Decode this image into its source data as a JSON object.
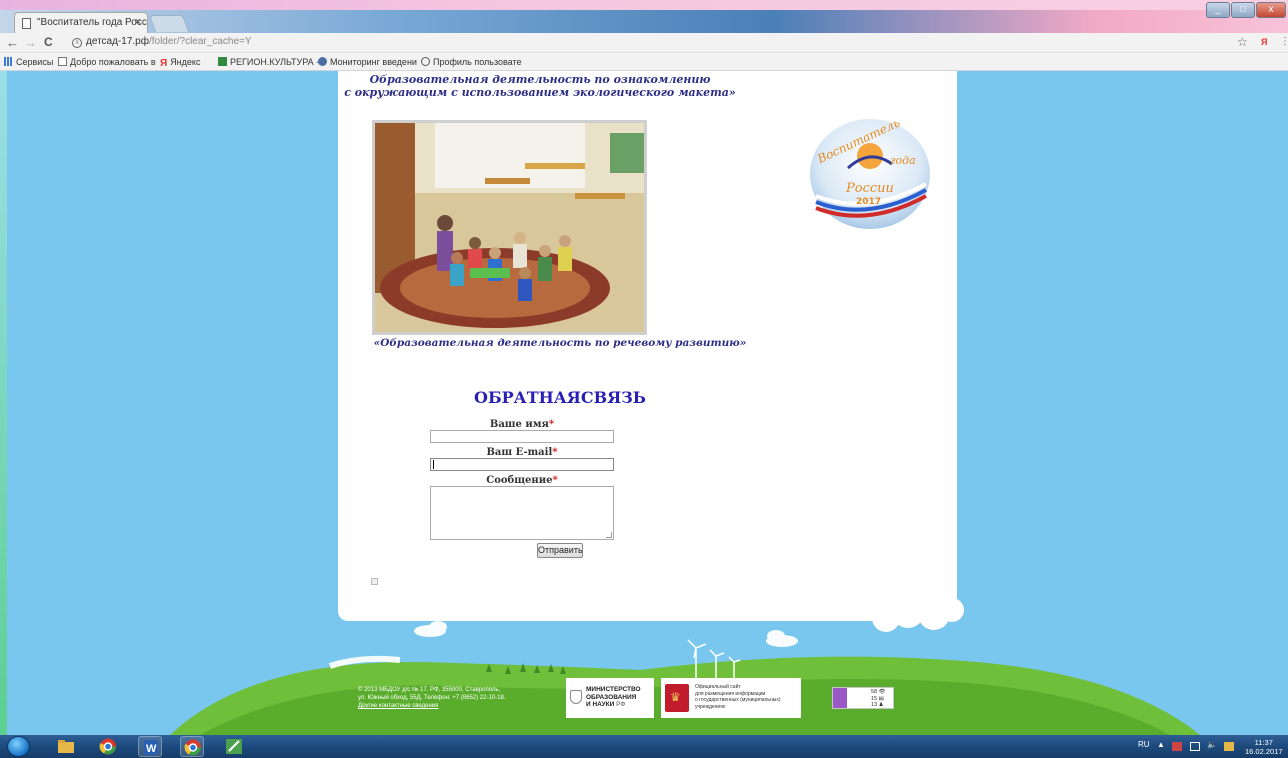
{
  "browser": {
    "tab_title": "\"Воспитатель года Росс",
    "tab_close": "×",
    "url_domain": "детсад-17.рф",
    "url_path": "/folder/?clear_cache=Y",
    "info_icon_glyph": "i",
    "nav": {
      "back": "←",
      "forward": "→",
      "reload": "C"
    },
    "star": "☆",
    "yandex_ext": "Я",
    "menu": "⋮",
    "window_controls": {
      "minimize": "_",
      "maximize": "□",
      "close": "x"
    }
  },
  "bookmarks": [
    {
      "label": "Сервисы",
      "icon": "apps-grid-icon",
      "color": "#3c78d8"
    },
    {
      "label": "Добро пожаловать в",
      "icon": "page-icon",
      "color": "#777777"
    },
    {
      "label": "Яндекс",
      "icon": "yandex-icon",
      "color": "#e3342f"
    },
    {
      "label": "РЕГИОН.КУЛЬТУРА -",
      "icon": "region-culture-icon",
      "color": "#2f8a3f"
    },
    {
      "label": "Мониторинг введени",
      "icon": "monitoring-icon",
      "color": "#4a6fa5"
    },
    {
      "label": "Профиль пользовате",
      "icon": "profile-icon",
      "color": "#555555"
    }
  ],
  "content": {
    "caption_top_line1": "Образовательная деятельность по ознакомлению",
    "caption_top_line2": "с окружающим с использованием экологического макета»",
    "caption_photo": "«Образовательная деятельность по речевому развитию»",
    "logo_text_top": "Воспитатель",
    "logo_text_mid": "года",
    "logo_text_bottom": "России",
    "logo_year": "2017"
  },
  "feedback": {
    "title": "ОБРАТНАЯСВЯЗЬ",
    "name_label": "Ваше имя",
    "email_label": "Ваш E-mail",
    "message_label": "Сообщение",
    "required_mark": "*",
    "submit_label": "Отправить",
    "name_value": "",
    "email_value": "",
    "message_value": ""
  },
  "footer": {
    "copyright_line1": "© 2013 МБДОУ д/с № 17. РФ, 355000, Ставрополь,",
    "copyright_line2": "ул. Южный обход, 55Д. Телефон: +7 (8652) 22-10-18.",
    "contacts_link": "Другие контактные сведения",
    "ministry_line1": "МИНИСТЕРСТВО",
    "ministry_line2": "ОБРАЗОВАНИЯ",
    "ministry_line3": "И НАУКИ",
    "ministry_rf": "РФ",
    "gov_line1": "Официальный сайт",
    "gov_line2": "для размещения информации",
    "gov_line3": "о государственных (муниципальных)",
    "gov_line4": "учреждениях",
    "counter_views": "58",
    "counter_visits": "15",
    "counter_hosts": "13",
    "counter_views_icon": "👁",
    "counter_visits_icon": "▤",
    "counter_hosts_icon": "♟"
  },
  "taskbar": {
    "apps": [
      {
        "name": "explorer",
        "color": "#e6b84a"
      },
      {
        "name": "chrome",
        "color": "#d9392d"
      },
      {
        "name": "word",
        "color": "#2b5fb4"
      },
      {
        "name": "chrome2",
        "color": "#d9392d"
      },
      {
        "name": "paint",
        "color": "#4ca14e"
      }
    ],
    "lang": "RU",
    "tray_arrow": "▲",
    "time": "11:37",
    "date": "16.02.2017"
  }
}
